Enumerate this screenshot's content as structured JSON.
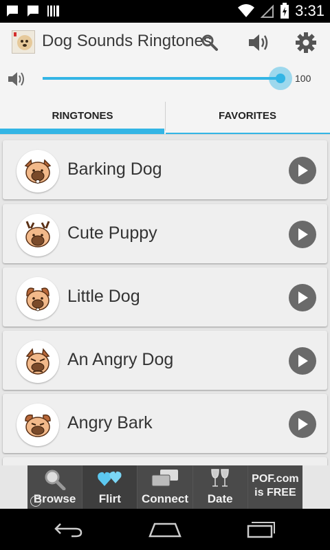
{
  "status_bar": {
    "time": "3:31",
    "icons": [
      "chat-icon",
      "chat-icon",
      "barcode-icon",
      "wifi-icon",
      "signal-off-icon",
      "battery-charging-icon"
    ]
  },
  "action_bar": {
    "title": "Dog Sounds Ringtones",
    "icons": [
      "app-icon",
      "search-icon",
      "volume-icon",
      "settings-icon"
    ]
  },
  "volume": {
    "value": "100",
    "level": 1.0
  },
  "tabs": [
    {
      "label": "RINGTONES",
      "selected": true
    },
    {
      "label": "FAVORITES",
      "selected": false
    }
  ],
  "ringtones": [
    {
      "name": "Barking Dog"
    },
    {
      "name": "Cute Puppy"
    },
    {
      "name": "Little Dog"
    },
    {
      "name": "An Angry Dog"
    },
    {
      "name": "Angry Bark"
    }
  ],
  "ad": {
    "items": [
      {
        "label": "Browse",
        "icon": "magnifier-icon"
      },
      {
        "label": "Flirt",
        "icon": "hearts-icon"
      },
      {
        "label": "Connect",
        "icon": "chat-bubbles-icon"
      },
      {
        "label": "Date",
        "icon": "wine-glasses-icon"
      },
      {
        "label": "POF.com is FREE",
        "icon": ""
      }
    ]
  },
  "colors": {
    "accent": "#33b5e5",
    "play_button": "#6a6a6a"
  }
}
